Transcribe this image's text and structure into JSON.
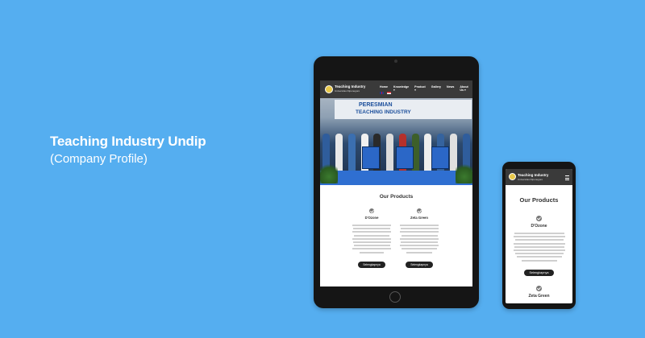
{
  "headline": {
    "title": "Teaching Industry Undip",
    "subtitle": "(Company Profile)"
  },
  "site": {
    "brand": "Teaching Industry",
    "brand_sub": "Universitas Diponegoro",
    "menu": [
      "Home",
      "Knowledge ▾",
      "Product ▾",
      "Gallery",
      "News",
      "About Us ▾"
    ],
    "hero_banner_line1": "PERESMIAN",
    "hero_banner_line2": "TEACHING INDUSTRY",
    "section_title": "Our Products",
    "products": [
      {
        "name": "D'Ozone",
        "button": "Selengkapnya"
      },
      {
        "name": "Zeta Green",
        "button": "Selengkapnya"
      }
    ]
  },
  "colors": {
    "background": "#55aef0",
    "nav": "#3a3a3a",
    "button": "#222222"
  }
}
